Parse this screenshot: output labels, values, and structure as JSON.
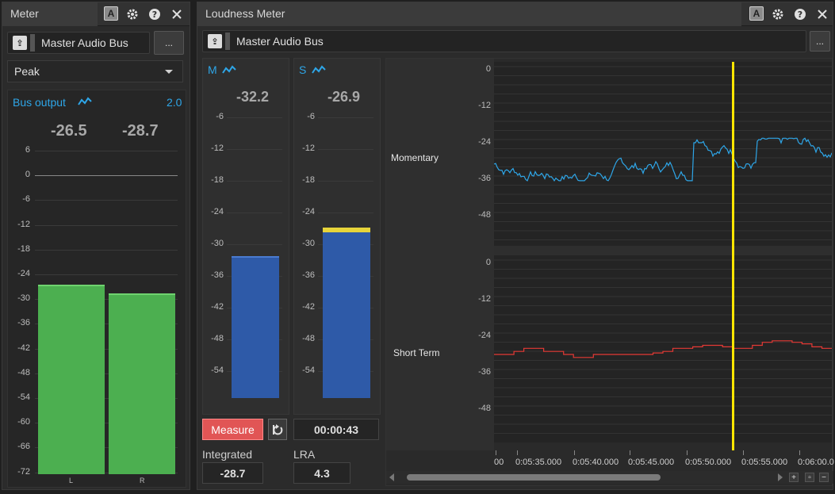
{
  "meter_panel": {
    "title": "Meter",
    "bus_name": "Master Audio Bus",
    "more_label": "...",
    "mode_value": "Peak",
    "output_label": "Bus output",
    "output_value": "2.0",
    "peak_left": "-26.5",
    "peak_right": "-28.7",
    "scale": [
      "6",
      "0",
      "-6",
      "-12",
      "-18",
      "-24",
      "-30",
      "-36",
      "-42",
      "-48",
      "-54",
      "-60",
      "-66",
      "-72"
    ],
    "channel_left": "L",
    "channel_right": "R",
    "level_left_db": -26.5,
    "level_right_db": -28.7,
    "bar_color": "#4caf50"
  },
  "loudness_panel": {
    "title": "Loudness Meter",
    "bus_name": "Master Audio Bus",
    "more_label": "...",
    "momentary": {
      "label": "M",
      "value": "-32.2",
      "level_db": -32.2
    },
    "shortterm": {
      "label": "S",
      "value": "-26.9",
      "level_db": -26.9
    },
    "scale": [
      "-6",
      "-12",
      "-18",
      "-24",
      "-30",
      "-36",
      "-42",
      "-48",
      "-54"
    ],
    "measure_label": "Measure",
    "elapsed": "00:00:43",
    "integrated_label": "Integrated",
    "integrated_value": "-28.7",
    "lra_label": "LRA",
    "lra_value": "4.3",
    "bar_color": "#2e5aa8",
    "accent_color": "#e6d43a",
    "measure_color": "#e15555"
  },
  "graph": {
    "momentary_label": "Momentary",
    "shortterm_label": "Short Term",
    "y_ticks": [
      "0",
      "-12",
      "-24",
      "-36",
      "-48"
    ],
    "time_ticks": [
      "00",
      "0:05:35.000",
      "0:05:40.000",
      "0:05:45.000",
      "0:05:50.000",
      "0:05:55.000",
      "0:06:00.0"
    ],
    "momentary_color": "#2ea6e8",
    "shortterm_color": "#e53935",
    "playhead_color": "#ffe600"
  }
}
